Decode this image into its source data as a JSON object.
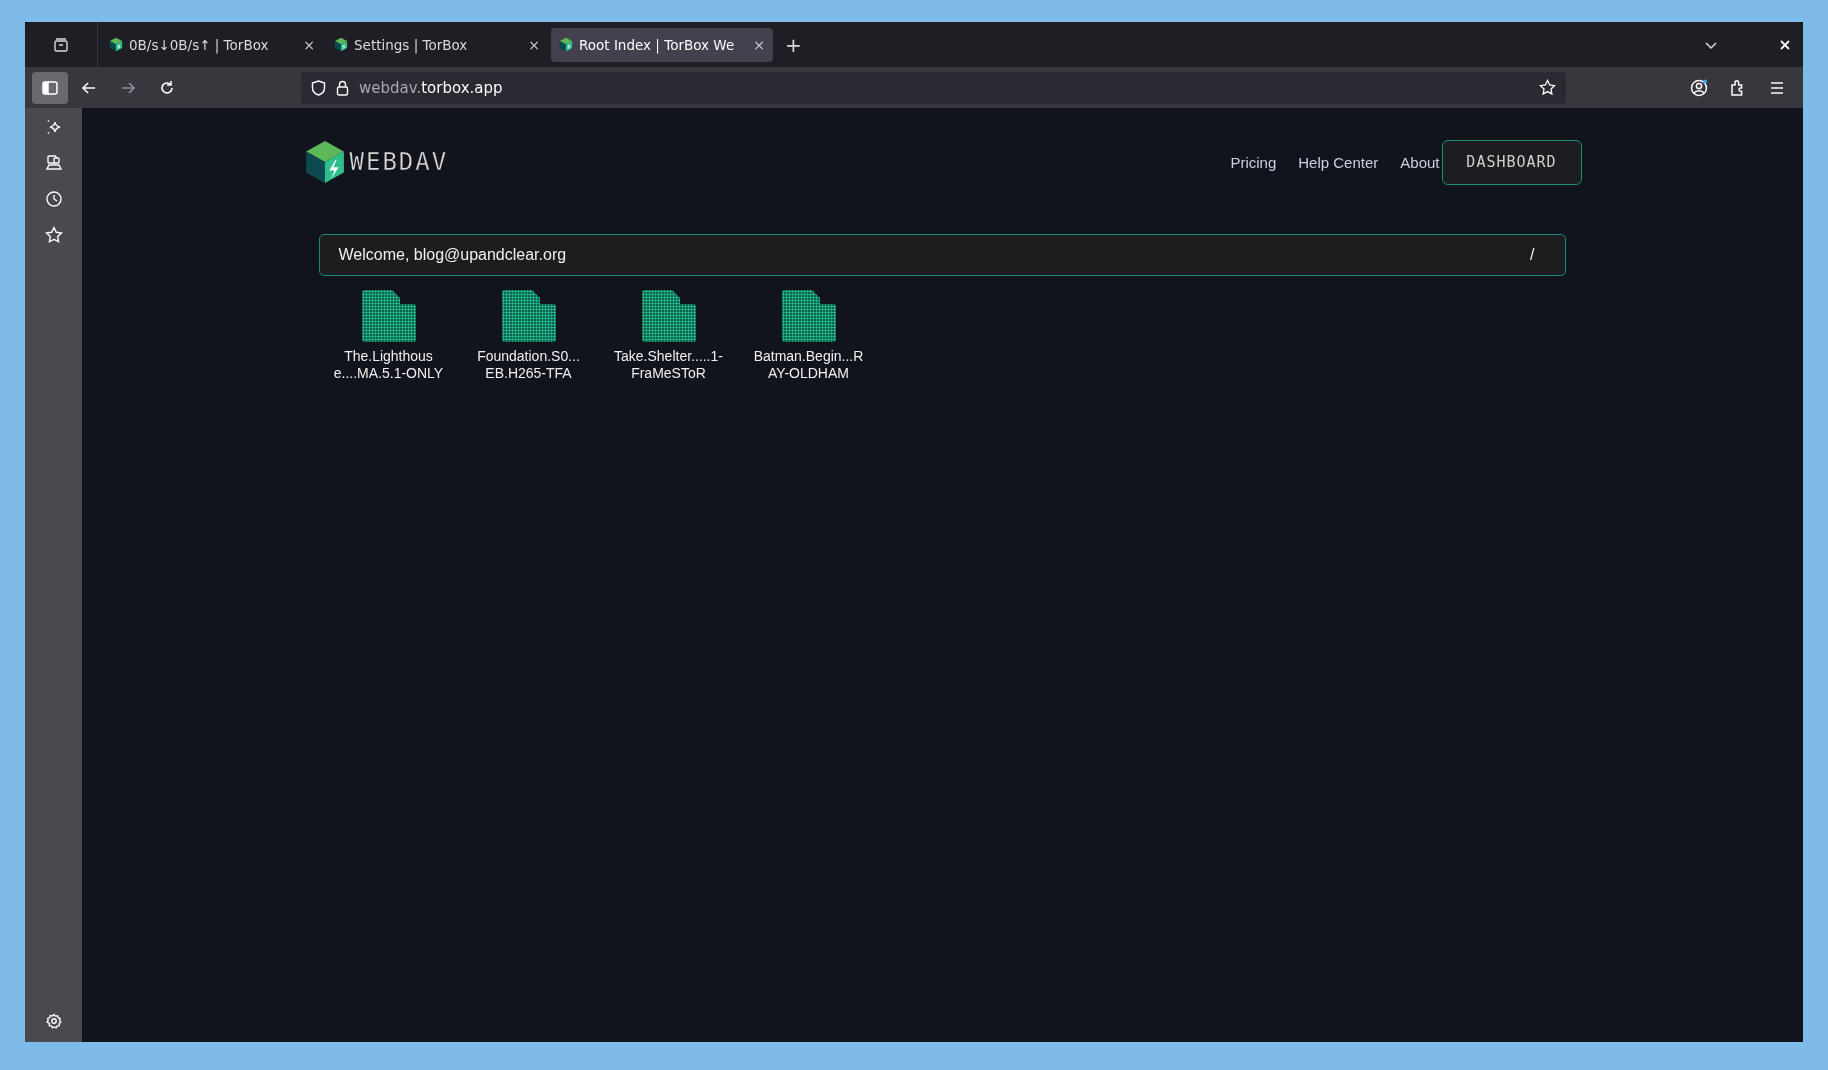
{
  "browser": {
    "tabs": [
      {
        "title": "0B/s↓0B/s↑ | TorBox",
        "selected": false
      },
      {
        "title": "Settings | TorBox",
        "selected": false
      },
      {
        "title": "Root Index | TorBox We",
        "selected": true
      }
    ],
    "tab_close": "×",
    "new_tab": "+",
    "url_prefix": "webdav.",
    "url_domain": "torbox.app"
  },
  "page": {
    "logo_text": "WEBDAV",
    "nav": [
      "Pricing",
      "Help Center",
      "About"
    ],
    "dashboard_button": "DASHBOARD",
    "welcome": "Welcome, blog@upandclear.org",
    "path": "/",
    "folders": [
      {
        "name": "The.Lighthouse....MA.5.1-ONLY"
      },
      {
        "name": "Foundation.S0...EB.H265-TFA"
      },
      {
        "name": "Take.Shelter.....1-FraMeSToR"
      },
      {
        "name": "Batman.Begin...RAY-OLDHAM"
      }
    ]
  }
}
